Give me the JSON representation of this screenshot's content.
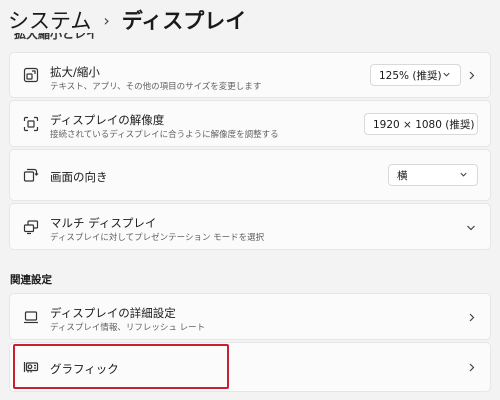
{
  "breadcrumb": {
    "parent": "システム",
    "separator": "›",
    "current": "ディスプレイ"
  },
  "cut_heading": "拡大縮小とレイアウト",
  "rows": [
    {
      "icon": "scale-icon",
      "title": "拡大/縮小",
      "subtitle": "テキスト、アプリ、その他の項目のサイズを変更します",
      "value": "125% (推奨)"
    },
    {
      "icon": "resolution-icon",
      "title": "ディスプレイの解像度",
      "subtitle": "接続されているディスプレイに合うように解像度を調整する",
      "value": "1920 × 1080 (推奨)"
    },
    {
      "icon": "orientation-icon",
      "title": "画面の向き",
      "value": "横"
    },
    {
      "icon": "multi-display-icon",
      "title": "マルチ ディスプレイ",
      "subtitle": "ディスプレイに対してプレゼンテーション モードを選択"
    }
  ],
  "related": {
    "label": "関連設定",
    "items": [
      {
        "icon": "laptop-icon",
        "title": "ディスプレイの詳細設定",
        "subtitle": "ディスプレイ情報、リフレッシュ レート"
      },
      {
        "icon": "graphics-card-icon",
        "title": "グラフィック"
      }
    ]
  },
  "colors": {
    "highlight": "#c8202f",
    "background": "#f3f3f3",
    "card": "#fbfbfb"
  }
}
